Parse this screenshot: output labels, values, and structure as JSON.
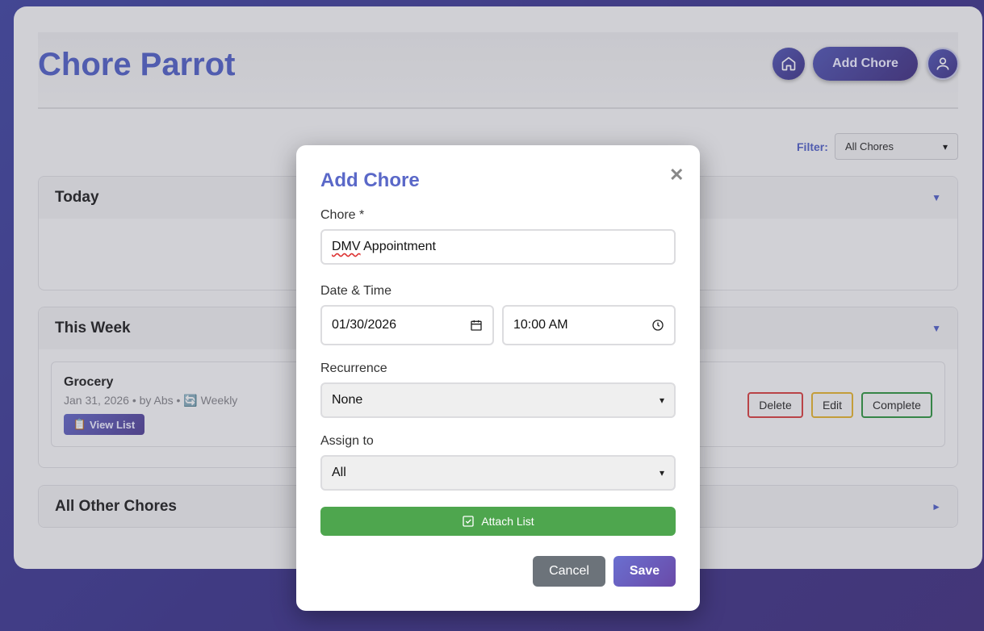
{
  "app": {
    "title": "Chore Parrot",
    "add_chore_label": "Add Chore",
    "filter_label": "Filter:",
    "filter_value": "All Chores"
  },
  "sections": [
    {
      "title": "Today",
      "expanded": true
    },
    {
      "title": "This Week",
      "expanded": true
    },
    {
      "title": "All Other Chores",
      "expanded": false
    }
  ],
  "week_chore": {
    "name": "Grocery",
    "meta": "Jan 31, 2026 • by Abs • 🔄 Weekly",
    "view_list_label": "View List",
    "delete_label": "Delete",
    "edit_label": "Edit",
    "complete_label": "Complete"
  },
  "modal": {
    "title": "Add Chore",
    "chore_label": "Chore *",
    "chore_value_word1": "DMV",
    "chore_value_rest": " Appointment",
    "datetime_label": "Date & Time",
    "date_value": "01/30/2026",
    "time_value": "10:00 AM",
    "recurrence_label": "Recurrence",
    "recurrence_value": "None",
    "assign_label": "Assign to",
    "assign_value": "All",
    "attach_label": "Attach List",
    "cancel_label": "Cancel",
    "save_label": "Save"
  },
  "colors": {
    "accent": "#5a68c8",
    "success": "#4ea64e",
    "danger": "#d94a4a",
    "warning": "#e6b83a"
  }
}
